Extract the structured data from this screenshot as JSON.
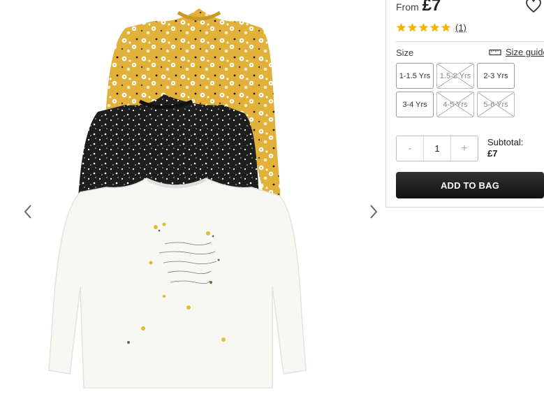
{
  "product": {
    "price_prefix": "From",
    "price": "£7",
    "rating_stars": 5,
    "review_count": "(1)",
    "star_color": "#f5b301"
  },
  "size": {
    "label": "Size",
    "guide_label": "Size guide",
    "options": [
      {
        "label": "1-1.5 Yrs",
        "available": true
      },
      {
        "label": "1.5-2 Yrs",
        "available": false
      },
      {
        "label": "2-3 Yrs",
        "available": true
      },
      {
        "label": "3-4 Yrs",
        "available": true
      },
      {
        "label": "4-5 Yrs",
        "available": false
      },
      {
        "label": "5-6 Yrs",
        "available": false
      }
    ]
  },
  "quantity": {
    "minus": "-",
    "plus": "+",
    "value": "1"
  },
  "subtotal": {
    "label": "Subtotal:",
    "value": "£7"
  },
  "cta": {
    "add_to_bag": "ADD TO BAG"
  },
  "gallery": {
    "image_label": "",
    "shirt_colors": {
      "yellow": "#e2b13a",
      "black": "#1e1e1e",
      "white": "#f7f7f4"
    }
  }
}
